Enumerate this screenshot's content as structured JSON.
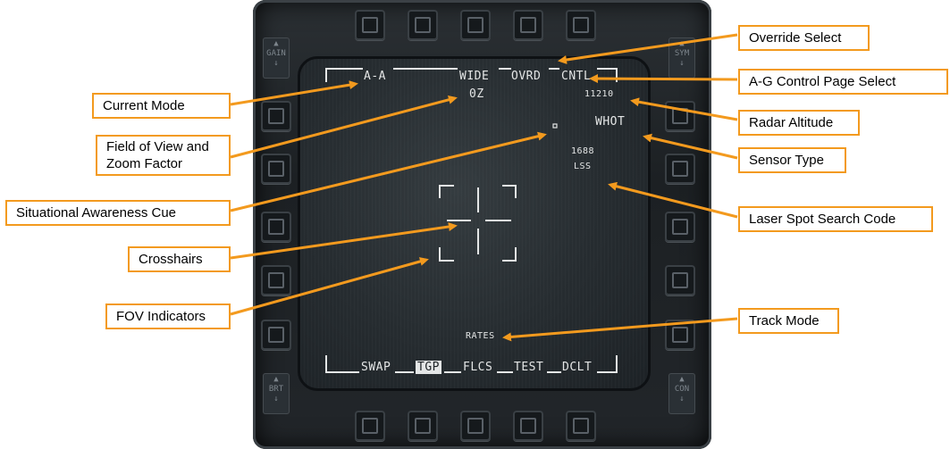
{
  "mfd": {
    "top_left_mode": "A-A",
    "top_wide": "WIDE",
    "top_ovrd": "OVRD",
    "top_cntl": "CNTL",
    "zoom": "0Z",
    "altitude": "11210",
    "sensor": "WHOT",
    "laser_code": "1688",
    "laser_mode": "LSS",
    "track_mode": "RATES",
    "bottom": {
      "swap": "SWAP",
      "tgp": "TGP",
      "flcs": "FLCS",
      "test": "TEST",
      "dclt": "DCLT"
    },
    "rockers": {
      "gain_top": "GAIN",
      "sym_top": "SYM",
      "brt_bottom": "BRT",
      "con_bottom": "CON"
    }
  },
  "callouts": {
    "override_select": "Override Select",
    "current_mode": "Current Mode",
    "ag_control_page_select": "A-G Control Page Select",
    "radar_altitude": "Radar Altitude",
    "fov_zoom_line1": "Field of View and",
    "fov_zoom_line2": "Zoom Factor",
    "sensor_type": "Sensor Type",
    "sa_cue": "Situational Awareness Cue",
    "laser_spot_search_code": "Laser Spot Search Code",
    "crosshairs": "Crosshairs",
    "fov_indicators": "FOV Indicators",
    "track_mode": "Track Mode"
  },
  "colors": {
    "callout_border": "#f39a1e",
    "arrow": "#f39a1e",
    "symbology": "#e4e6e6"
  }
}
